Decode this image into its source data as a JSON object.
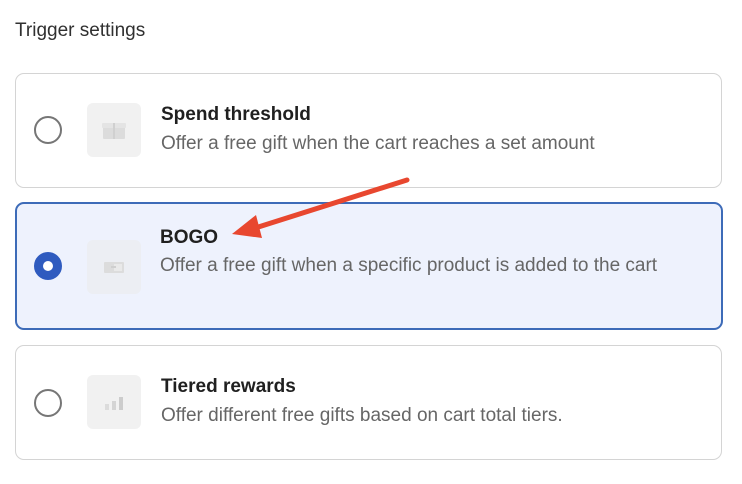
{
  "section": {
    "title": "Trigger settings"
  },
  "options": [
    {
      "title": "Spend threshold",
      "description": "Offer a free gift when the cart reaches a set amount",
      "icon": "gift-box-icon",
      "selected": false
    },
    {
      "title": "BOGO",
      "description": "Offer a free gift when a specific product is added to the cart",
      "icon": "bogo-tag-icon",
      "selected": true
    },
    {
      "title": "Tiered rewards",
      "description": "Offer different free gifts based on cart total tiers.",
      "icon": "tiers-bar-icon",
      "selected": false
    }
  ],
  "colors": {
    "selected_border": "#3d6bb8",
    "selected_background": "#eef2fd",
    "radio_checked": "#2f5bbf",
    "annotation_arrow": "#e8472f"
  }
}
